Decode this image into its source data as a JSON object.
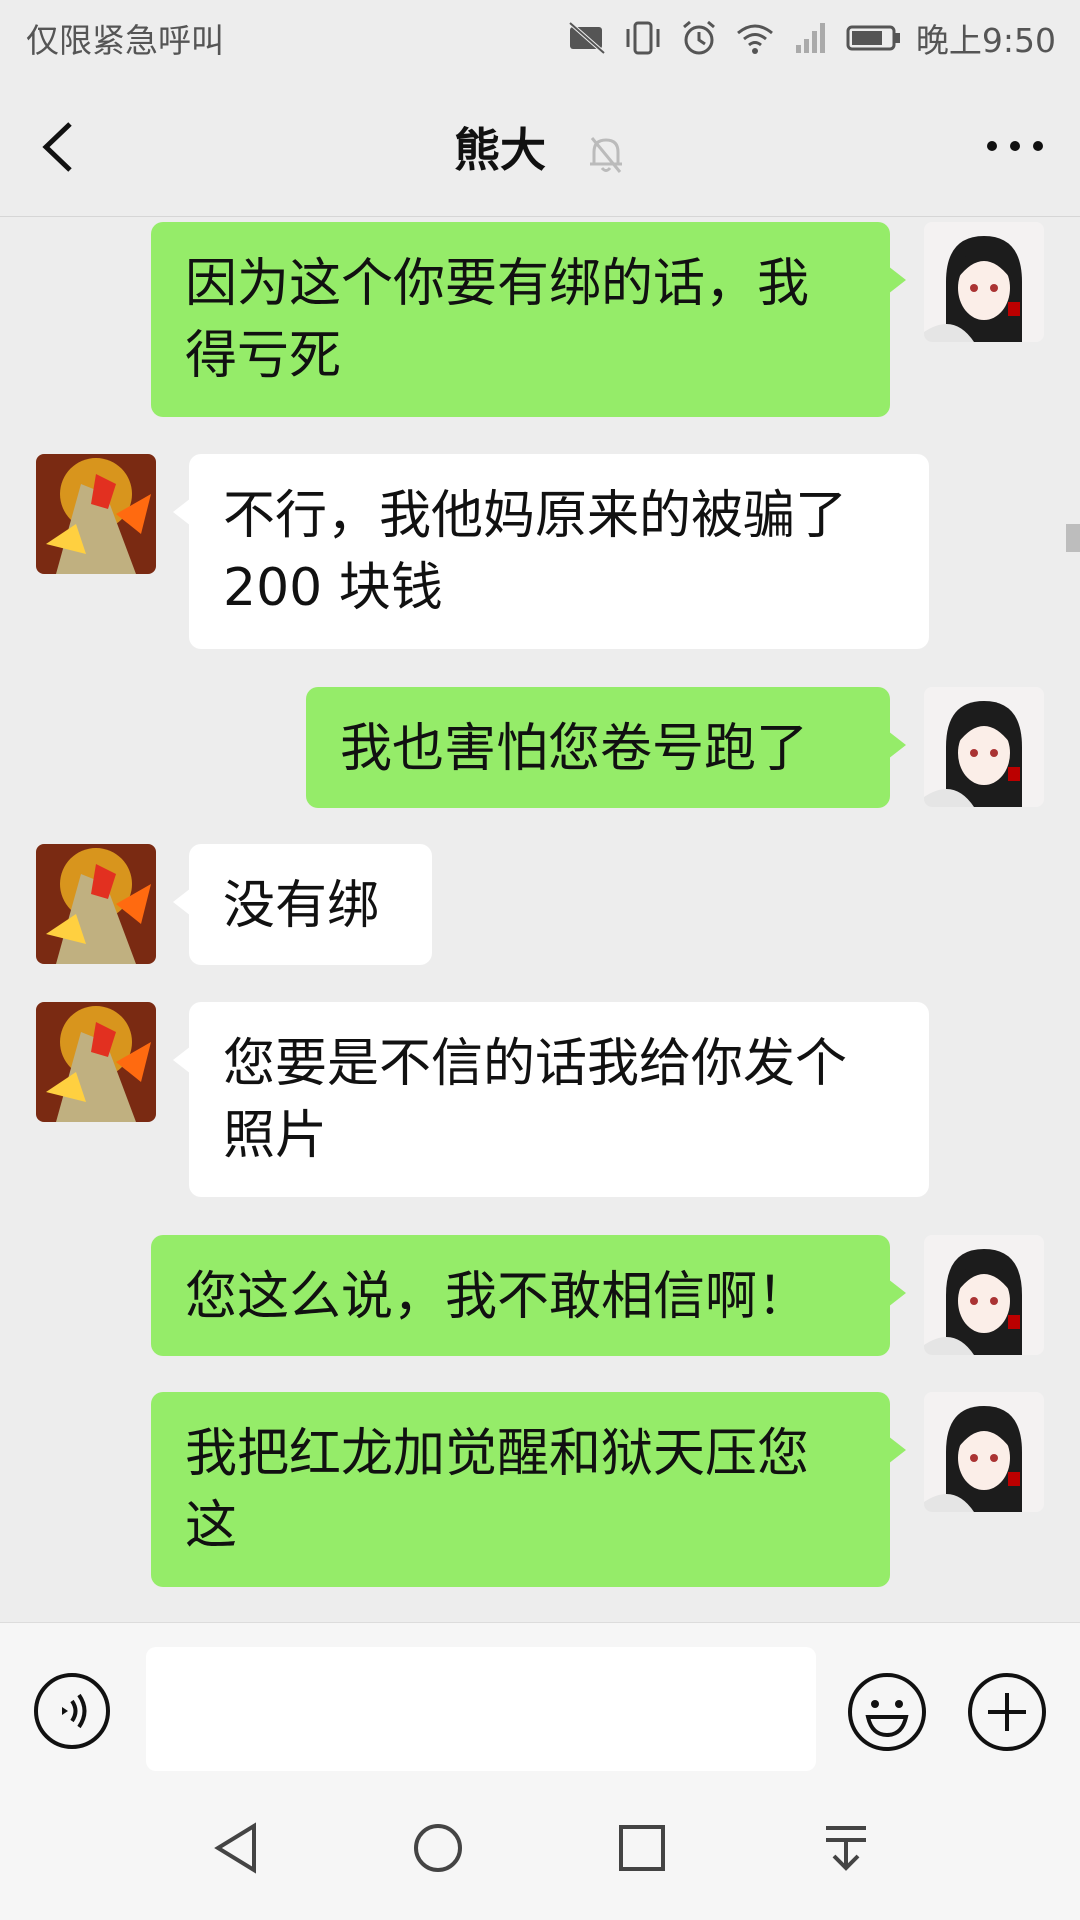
{
  "status_bar": {
    "carrier_text": "仅限紧急呼叫",
    "time": "晚上9:50",
    "icons": [
      "sim-disabled-icon",
      "vibrate-icon",
      "alarm-icon",
      "wifi-icon",
      "signal-icon",
      "battery-icon"
    ]
  },
  "header": {
    "title": "熊大",
    "mute_icon": "bell-off-icon",
    "back_icon": "chevron-left-icon",
    "more_icon": "more-dots-icon"
  },
  "colors": {
    "sent_bubble": "#95ec69",
    "received_bubble": "#ffffff",
    "background": "#ededed"
  },
  "messages": [
    {
      "from": "me",
      "text_lines": [
        "因为这个你要有绑的话，我",
        "得亏死"
      ]
    },
    {
      "from": "them",
      "text_lines": [
        "不行，我他妈原来的被骗了",
        "200 块钱"
      ]
    },
    {
      "from": "me",
      "text_lines": [
        "我也害怕您卷号跑了"
      ]
    },
    {
      "from": "them",
      "text_lines": [
        "没有绑"
      ]
    },
    {
      "from": "them",
      "text_lines": [
        "您要是不信的话我给你发个",
        "照片"
      ]
    },
    {
      "from": "me",
      "text_lines": [
        "您这么说，我不敢相信啊！"
      ]
    },
    {
      "from": "me",
      "text_lines": [
        "我把红龙加觉醒和狱天压您",
        "这"
      ]
    }
  ],
  "input_bar": {
    "voice_icon": "voice-icon",
    "input_value": "",
    "emoji_icon": "emoji-icon",
    "plus_icon": "plus-circle-icon"
  },
  "nav_bar": {
    "icons": [
      "back-triangle-icon",
      "home-circle-icon",
      "recents-square-icon",
      "notification-pull-icon"
    ]
  }
}
